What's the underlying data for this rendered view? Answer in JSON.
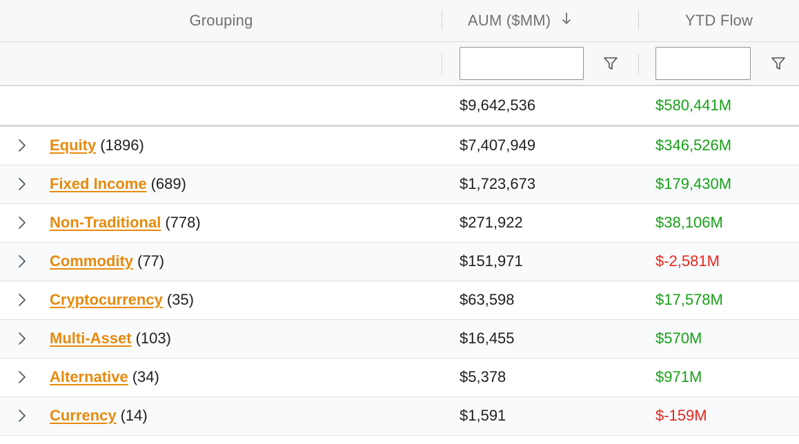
{
  "header": {
    "grouping": "Grouping",
    "aum": "AUM ($MM)",
    "ytd_flow": "YTD Flow",
    "sort_icon": "arrow-down-icon"
  },
  "filters": {
    "aum_value": "",
    "flow_value": "",
    "filter_icon": "funnel-icon"
  },
  "total": {
    "aum": "$9,642,536",
    "flow": "$580,441M"
  },
  "colors": {
    "link": "#e88a0c",
    "positive": "#18a018",
    "negative": "#e8261e"
  },
  "rows": [
    {
      "name": "Equity",
      "count": "(1896)",
      "aum": "$7,407,949",
      "flow": "$346,526M",
      "sign": "pos"
    },
    {
      "name": "Fixed Income",
      "count": "(689)",
      "aum": "$1,723,673",
      "flow": "$179,430M",
      "sign": "pos"
    },
    {
      "name": "Non-Traditional",
      "count": "(778)",
      "aum": "$271,922",
      "flow": "$38,106M",
      "sign": "pos"
    },
    {
      "name": "Commodity",
      "count": "(77)",
      "aum": "$151,971",
      "flow": "$-2,581M",
      "sign": "neg"
    },
    {
      "name": "Cryptocurrency",
      "count": "(35)",
      "aum": "$63,598",
      "flow": "$17,578M",
      "sign": "pos"
    },
    {
      "name": "Multi-Asset",
      "count": "(103)",
      "aum": "$16,455",
      "flow": "$570M",
      "sign": "pos"
    },
    {
      "name": "Alternative",
      "count": "(34)",
      "aum": "$5,378",
      "flow": "$971M",
      "sign": "pos"
    },
    {
      "name": "Currency",
      "count": "(14)",
      "aum": "$1,591",
      "flow": "$-159M",
      "sign": "neg"
    }
  ]
}
